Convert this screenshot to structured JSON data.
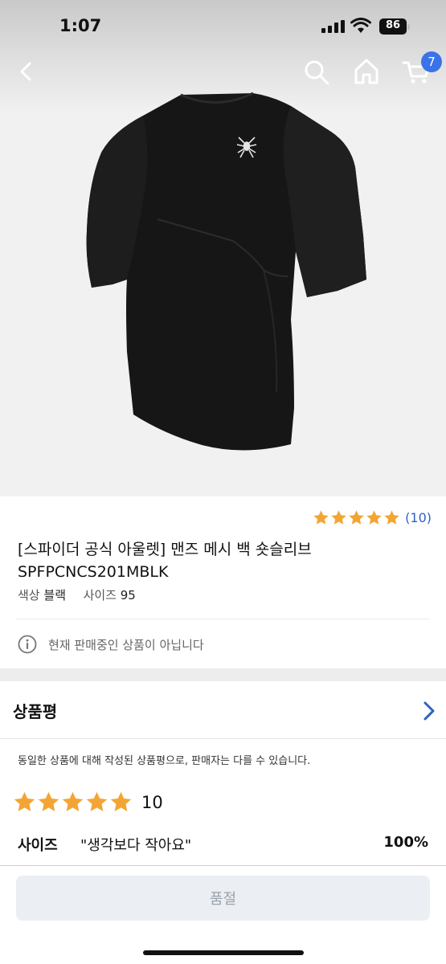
{
  "status_bar": {
    "time": "1:07",
    "battery": "86"
  },
  "nav": {
    "cart_count": "7",
    "icons": [
      "back-arrow-icon",
      "search-icon",
      "home-icon",
      "cart-icon"
    ]
  },
  "product": {
    "image": "black short-sleeve compression shirt with white spider logo",
    "rating_value": 5,
    "review_count": "(10)",
    "title": "[스파이더 공식 아울렛] 맨즈 메시 백 숏슬리브 SPFPCNCS201MBLK",
    "color_label": "색상",
    "color_value": "블랙",
    "size_label": "사이즈",
    "size_value": "95",
    "notice": "현재 판매중인 상품이 아닙니다"
  },
  "reviews": {
    "heading": "상품평",
    "notice": "동일한 상품에 대해 작성된 상품평으로, 판매자는 다를 수 있습니다.",
    "stars": 5,
    "average": "10",
    "size_label": "사이즈",
    "size_quote": "\"생각보다 작아요\"",
    "size_percent": "100%"
  },
  "bottom": {
    "button_label": "품절"
  },
  "colors": {
    "star": "#f3a534",
    "link_blue": "#2f62c4",
    "badge_blue": "#3a73e8",
    "disabled_bg": "#ebeef2",
    "disabled_text": "#9aa3ad"
  }
}
